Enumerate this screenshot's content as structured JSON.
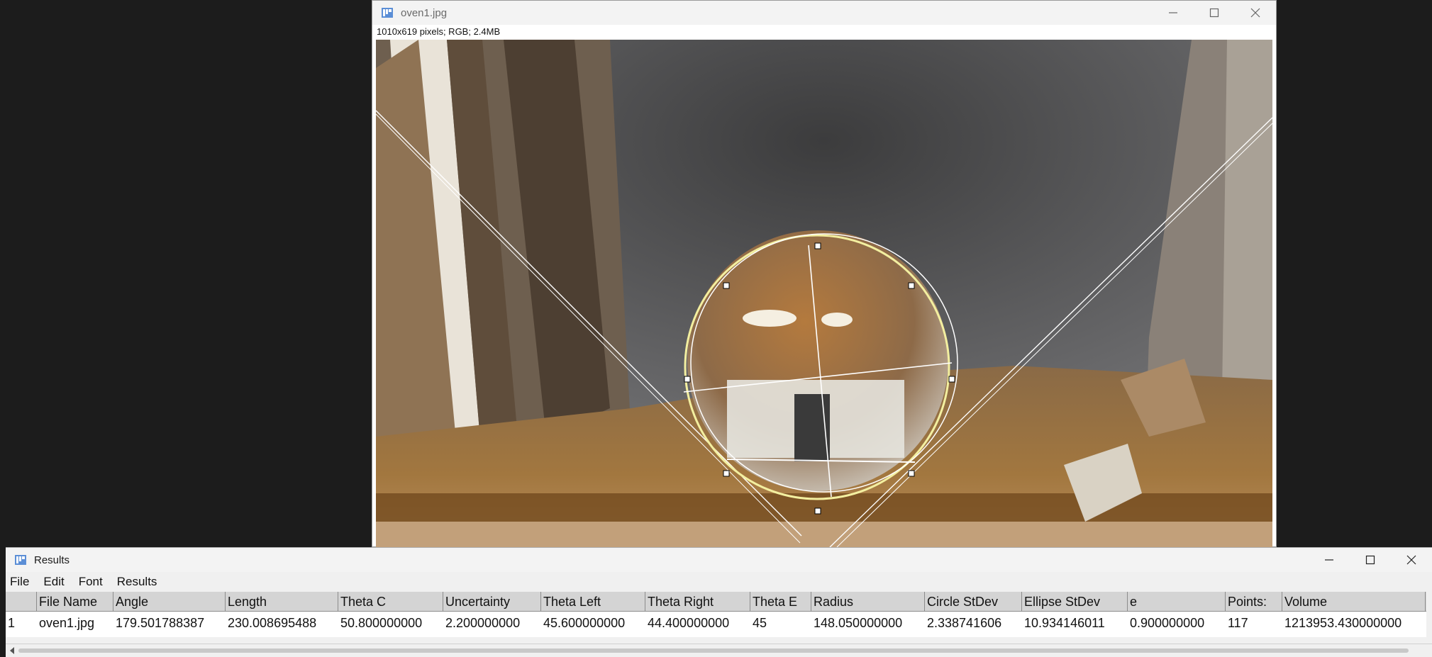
{
  "image_window": {
    "title": "oven1.jpg",
    "info": "1010x619 pixels; RGB; 2.4MB"
  },
  "results_window": {
    "title": "Results",
    "menu": [
      "File",
      "Edit",
      "Font",
      "Results"
    ],
    "columns": [
      "",
      "File Name",
      "Angle",
      "Length",
      "Theta C",
      "Uncertainty",
      "Theta Left",
      "Theta Right",
      "Theta E",
      "Radius",
      "Circle StDev",
      "Ellipse StDev",
      "e",
      "Points:",
      "Volume"
    ],
    "rows": [
      [
        "1",
        "oven1.jpg",
        "179.501788387",
        "230.008695488",
        "50.800000000",
        "2.200000000",
        "45.600000000",
        "44.400000000",
        "45",
        "148.050000000",
        "2.338741606",
        "10.934146011",
        "0.900000000",
        "117",
        "1213953.430000000"
      ]
    ]
  },
  "icons": {
    "app": "imagej-icon",
    "minimize": "minimize-icon",
    "maximize": "maximize-icon",
    "close": "close-icon"
  },
  "colors": {
    "background": "#1c1c1c",
    "overlay_circle": "#f3efa0",
    "overlay_lines": "#ffffff",
    "table_header": "#d4d4d4"
  }
}
